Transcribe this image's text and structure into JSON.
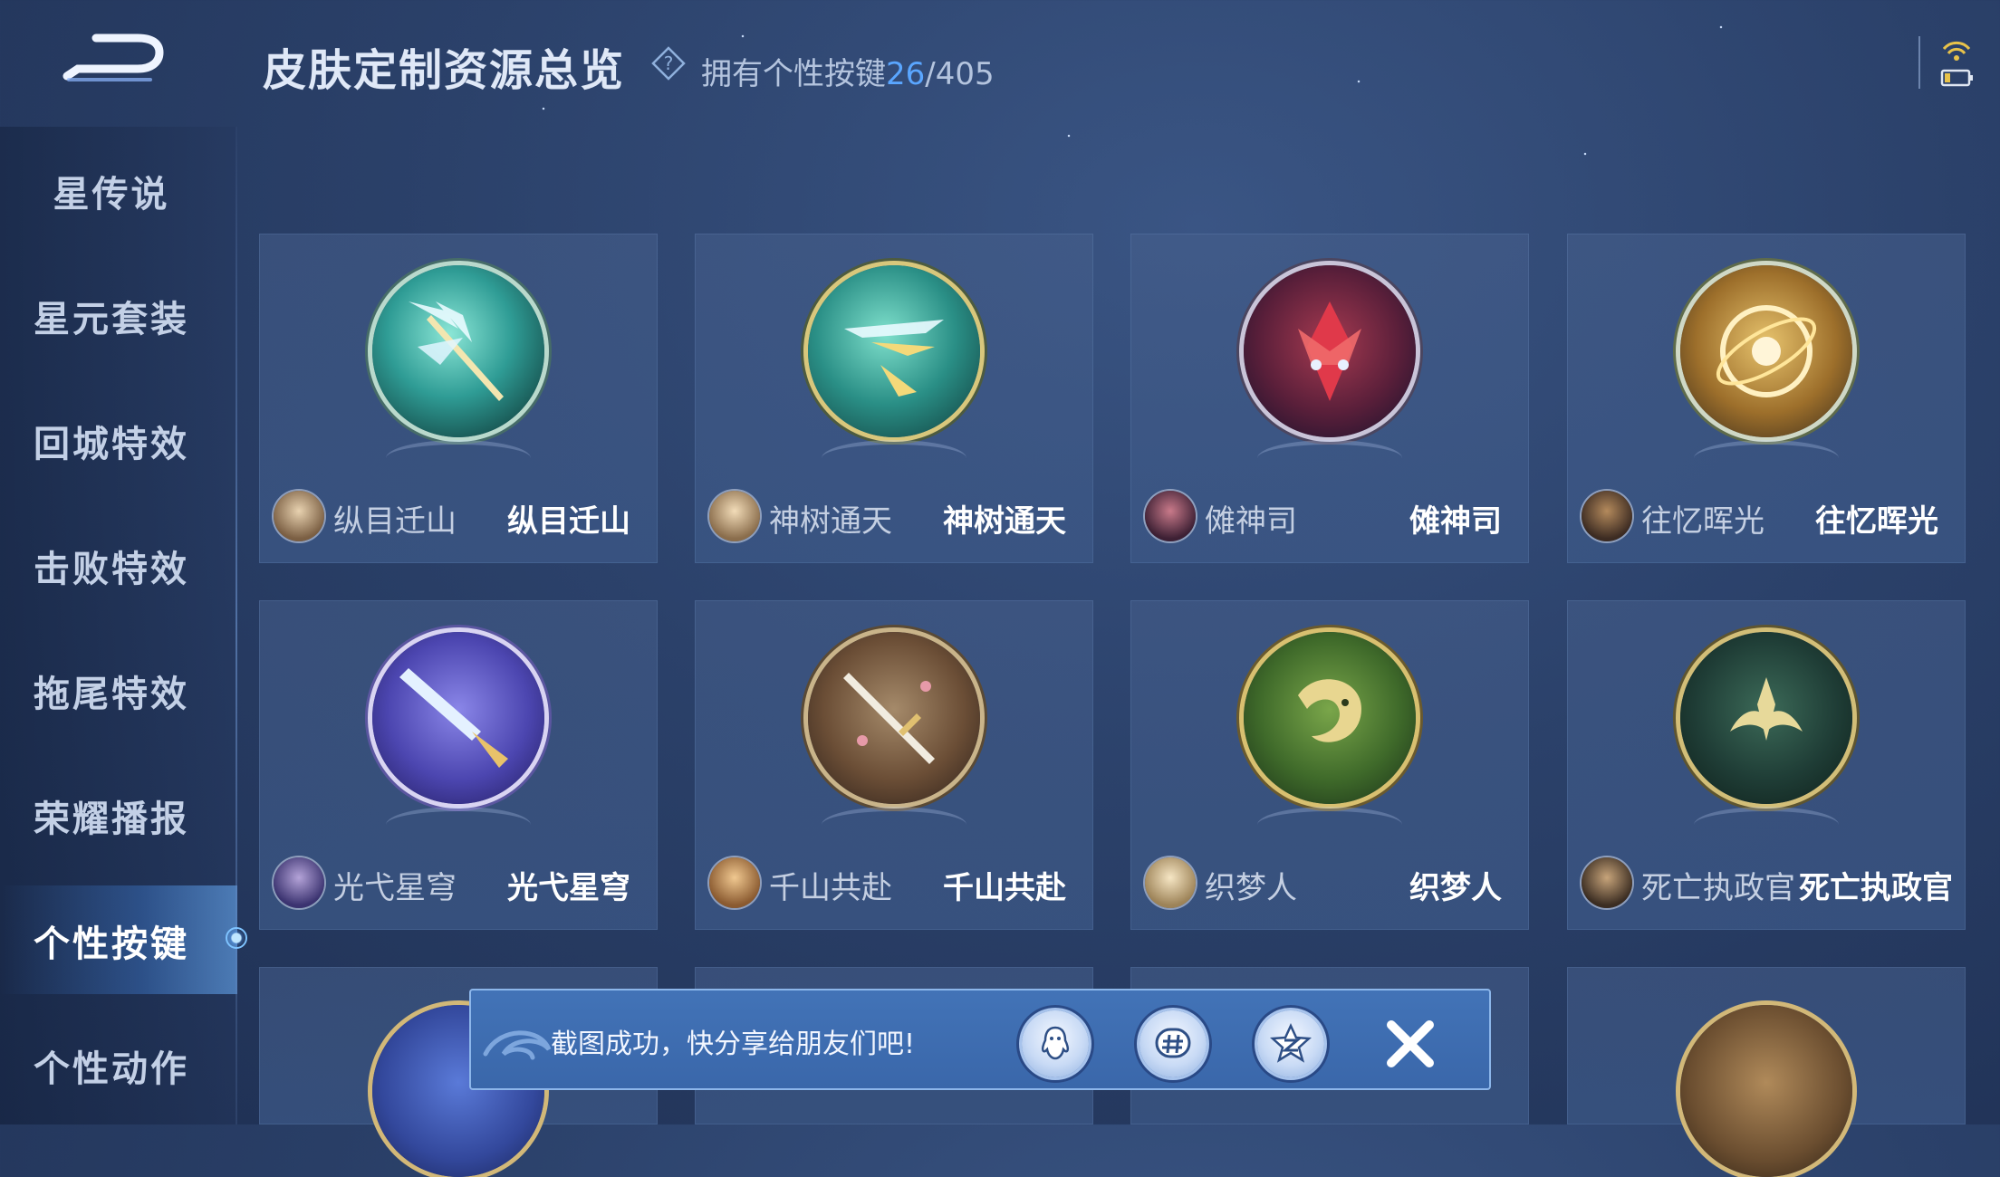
{
  "header": {
    "title": "皮肤定制资源总览",
    "owned_label": "拥有个性按键",
    "owned_count": "26",
    "owned_total": "/405"
  },
  "sidebar": {
    "items": [
      {
        "label": "星传说"
      },
      {
        "label": "星元套装"
      },
      {
        "label": "回城特效"
      },
      {
        "label": "击败特效"
      },
      {
        "label": "拖尾特效"
      },
      {
        "label": "荣耀播报"
      },
      {
        "label": "个性按键",
        "active": true
      },
      {
        "label": "个性动作"
      }
    ]
  },
  "cards": [
    {
      "hero": "纵目迁山",
      "skin": "纵目迁山",
      "emblem": "spear-emblem-icon"
    },
    {
      "hero": "神树通天",
      "skin": "神树通天",
      "emblem": "branch-emblem-icon"
    },
    {
      "hero": "傩神司",
      "skin": "傩神司",
      "emblem": "mask-emblem-icon"
    },
    {
      "hero": "往忆晖光",
      "skin": "往忆晖光",
      "emblem": "gyroscope-emblem-icon"
    },
    {
      "hero": "光弋星穹",
      "skin": "光弋星穹",
      "emblem": "crystal-sword-emblem-icon"
    },
    {
      "hero": "千山共赴",
      "skin": "千山共赴",
      "emblem": "sword-emblem-icon"
    },
    {
      "hero": "织梦人",
      "skin": "织梦人",
      "emblem": "dragon-emblem-icon"
    },
    {
      "hero": "死亡执政官",
      "skin": "死亡执政官",
      "emblem": "reaper-emblem-icon"
    }
  ],
  "share_toast": {
    "message": "截图成功，快分享给朋友们吧!",
    "buttons": [
      "qq-share-icon",
      "wechat-share-icon",
      "qzone-share-icon"
    ]
  },
  "colors": {
    "accent": "#5aa6ff",
    "background": "#2b416a",
    "toast": "#4273b7"
  }
}
